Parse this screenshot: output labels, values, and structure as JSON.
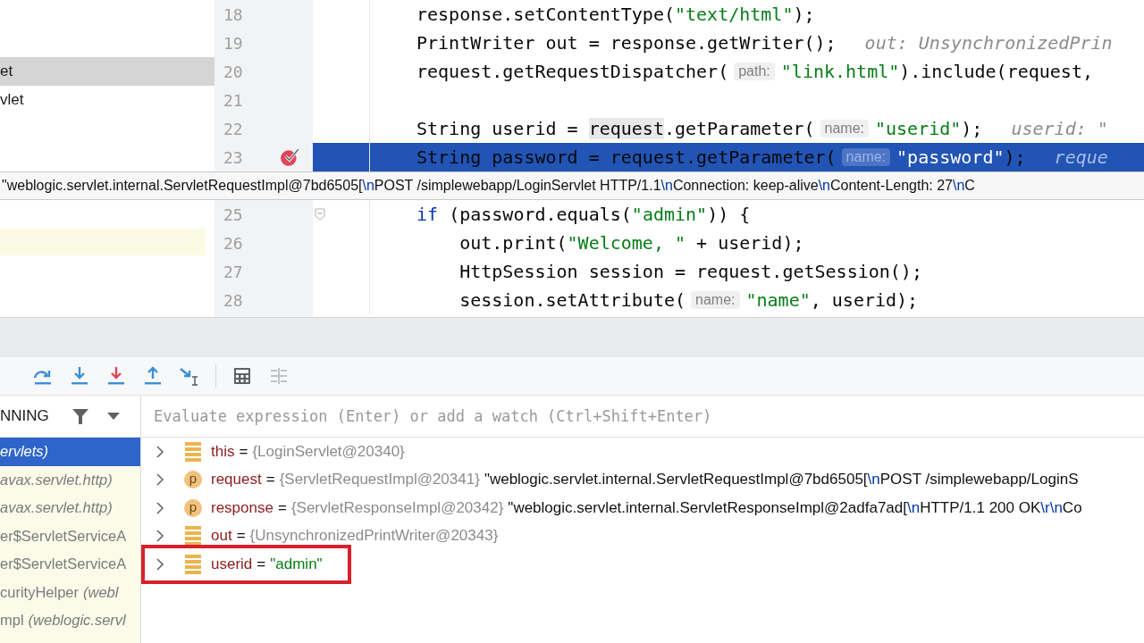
{
  "project_tree": {
    "items": [
      {
        "label": "et",
        "selected": true
      },
      {
        "label": "vlet",
        "selected": false
      }
    ]
  },
  "editor": {
    "lines_before_tooltip": [
      {
        "number": "18",
        "selected": false,
        "breakpoint": false,
        "foldable": false,
        "parts": [
          {
            "kind": "plain",
            "text": "response.setContentType("
          },
          {
            "kind": "string",
            "text": "\"text/html\""
          },
          {
            "kind": "plain",
            "text": ");"
          }
        ]
      },
      {
        "number": "19",
        "selected": false,
        "breakpoint": false,
        "foldable": false,
        "parts": [
          {
            "kind": "plain",
            "text": "PrintWriter out = response.getWriter();"
          },
          {
            "kind": "inline",
            "text": "out: UnsynchronizedPrin"
          }
        ]
      },
      {
        "number": "20",
        "selected": false,
        "breakpoint": false,
        "foldable": false,
        "parts": [
          {
            "kind": "plain",
            "text": "request.getRequestDispatcher("
          },
          {
            "kind": "hint",
            "text": "path:"
          },
          {
            "kind": "string",
            "text": "\"link.html\""
          },
          {
            "kind": "plain",
            "text": ").include(request,"
          }
        ]
      },
      {
        "number": "21",
        "selected": false,
        "breakpoint": false,
        "foldable": false
      },
      {
        "number": "22",
        "selected": false,
        "breakpoint": false,
        "foldable": false,
        "parts": [
          {
            "kind": "plain",
            "text": "String userid = "
          },
          {
            "kind": "ref",
            "text": "request"
          },
          {
            "kind": "plain",
            "text": ".getParameter("
          },
          {
            "kind": "hint",
            "text": "name:"
          },
          {
            "kind": "string",
            "text": "\"userid\""
          },
          {
            "kind": "plain",
            "text": ");"
          },
          {
            "kind": "inline",
            "text": "userid: \""
          }
        ]
      },
      {
        "number": "23",
        "selected": true,
        "breakpoint": true,
        "foldable": false,
        "parts": [
          {
            "kind": "plain",
            "text": "String password = request.getParameter("
          },
          {
            "kind": "hint",
            "text": "name:"
          },
          {
            "kind": "string",
            "text": "\"password\""
          },
          {
            "kind": "plain",
            "text": ");"
          },
          {
            "kind": "inline",
            "text": "reque"
          }
        ]
      }
    ],
    "tooltip": [
      {
        "kind": "text",
        "text": "\"weblogic.servlet.internal.ServletRequestImpl@7bd6505["
      },
      {
        "kind": "escape",
        "text": "\\n"
      },
      {
        "kind": "text",
        "text": "POST /simplewebapp/LoginServlet HTTP/1.1"
      },
      {
        "kind": "escape",
        "text": "\\n"
      },
      {
        "kind": "text",
        "text": "Connection: keep-alive"
      },
      {
        "kind": "escape",
        "text": "\\n"
      },
      {
        "kind": "text",
        "text": "Content-Length: 27"
      },
      {
        "kind": "escape",
        "text": "\\n"
      },
      {
        "kind": "text",
        "text": "C"
      }
    ],
    "lines_after_tooltip": [
      {
        "number": "25",
        "selected": false,
        "breakpoint": false,
        "foldable": true,
        "parts": [
          {
            "kind": "keyword",
            "text": "if"
          },
          {
            "kind": "plain",
            "text": " (password.equals("
          },
          {
            "kind": "string",
            "text": "\"admin\""
          },
          {
            "kind": "plain",
            "text": ")) {"
          }
        ]
      },
      {
        "number": "26",
        "selected": false,
        "breakpoint": false,
        "foldable": false,
        "parts": [
          {
            "kind": "plain",
            "text": "    out.print("
          },
          {
            "kind": "string",
            "text": "\"Welcome, \""
          },
          {
            "kind": "plain",
            "text": " + userid);"
          }
        ]
      },
      {
        "number": "27",
        "selected": false,
        "breakpoint": false,
        "foldable": false,
        "parts": [
          {
            "kind": "plain",
            "text": "    HttpSession session = request.getSession();"
          }
        ]
      },
      {
        "number": "28",
        "selected": false,
        "breakpoint": false,
        "foldable": false,
        "parts": [
          {
            "kind": "plain",
            "text": "    session.setAttribute("
          },
          {
            "kind": "hint",
            "text": "name:"
          },
          {
            "kind": "string",
            "text": "\"name\""
          },
          {
            "kind": "plain",
            "text": ", userid);"
          }
        ]
      }
    ]
  },
  "debugger": {
    "toolbar": [
      {
        "kind": "step-over"
      },
      {
        "kind": "step-into"
      },
      {
        "kind": "force-step-into"
      },
      {
        "kind": "step-out"
      },
      {
        "kind": "run-to-cursor"
      },
      {
        "kind": "separator"
      },
      {
        "kind": "evaluate"
      },
      {
        "kind": "trace",
        "disabled": true
      }
    ],
    "frames_header": "NNING",
    "frames": [
      {
        "package": "ervlets)",
        "selected": true
      },
      {
        "package": "avax.servlet.http)",
        "selected": false
      },
      {
        "package": "avax.servlet.http)",
        "selected": false
      },
      {
        "name": "er$ServletServiceA",
        "selected": false
      },
      {
        "name": "er$ServletServiceA",
        "selected": false
      },
      {
        "name": "curityHelper",
        "package": "(webl",
        "selected": false
      },
      {
        "name": "mpl",
        "package": "(weblogic.servl",
        "selected": false
      }
    ],
    "evaluate_placeholder": "Evaluate expression (Enter) or add a watch (Ctrl+Shift+Enter)",
    "variables": [
      {
        "kind": "field",
        "name": "this",
        "op": "=",
        "type_ref": "{LoginServlet@20340}",
        "highlighted": false
      },
      {
        "kind": "param",
        "badge": "p",
        "name": "request",
        "op": "=",
        "type_ref": "{ServletRequestImpl@20341}",
        "highlighted": false,
        "value": [
          {
            "kind": "text",
            "text": "\"weblogic.servlet.internal.ServletRequestImpl@7bd6505["
          },
          {
            "kind": "escape",
            "text": "\\n"
          },
          {
            "kind": "text",
            "text": "POST /simplewebapp/LoginS"
          }
        ]
      },
      {
        "kind": "param",
        "badge": "p",
        "name": "response",
        "op": "=",
        "type_ref": "{ServletResponseImpl@20342}",
        "highlighted": false,
        "value": [
          {
            "kind": "text",
            "text": "\"weblogic.servlet.internal.ServletResponseImpl@2adfa7ad["
          },
          {
            "kind": "escape",
            "text": "\\n"
          },
          {
            "kind": "text",
            "text": "HTTP/1.1 200 OK"
          },
          {
            "kind": "escape",
            "text": "\\r\\n"
          },
          {
            "kind": "text",
            "text": "Co"
          }
        ]
      },
      {
        "kind": "field",
        "name": "out",
        "op": "=",
        "type_ref": "{UnsynchronizedPrintWriter@20343}",
        "highlighted": false
      },
      {
        "kind": "field",
        "name": "userid",
        "op": "=",
        "highlighted": true,
        "value": [
          {
            "kind": "string",
            "text": "\"admin\""
          }
        ]
      }
    ]
  }
}
